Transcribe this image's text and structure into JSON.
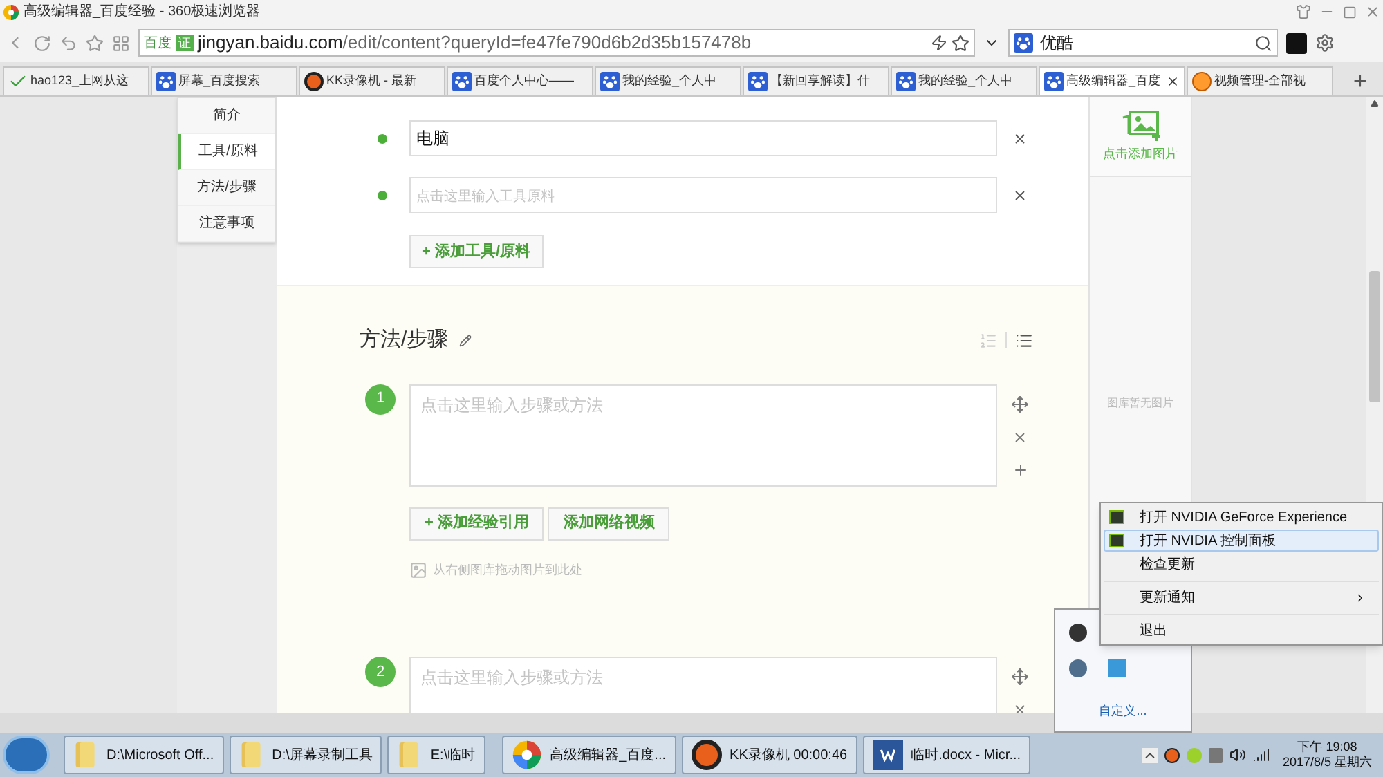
{
  "window": {
    "title": "高级编辑器_百度经验 - 360极速浏览器"
  },
  "toolbar": {
    "site_label": "百度",
    "cert_badge": "证",
    "url_host": "jingyan.baidu.com",
    "url_path": "/edit/content?queryId=fe47fe790d6b2d35b157478b",
    "search_value": "优酷"
  },
  "tabs": [
    {
      "label": "hao123_上网从这",
      "kind": "check",
      "selected": false
    },
    {
      "label": "屏幕_百度搜索",
      "kind": "paw",
      "selected": false
    },
    {
      "label": "KK录像机 - 最新",
      "kind": "recorder",
      "selected": false
    },
    {
      "label": "百度个人中心——",
      "kind": "paw",
      "selected": false
    },
    {
      "label": "我的经验_个人中",
      "kind": "paw",
      "selected": false
    },
    {
      "label": "【新回享解读】什",
      "kind": "paw",
      "selected": false
    },
    {
      "label": "我的经验_个人中",
      "kind": "paw",
      "selected": false
    },
    {
      "label": "高级编辑器_百度",
      "kind": "paw",
      "selected": true
    },
    {
      "label": "视频管理-全部视",
      "kind": "video",
      "selected": false
    }
  ],
  "nav": [
    {
      "label": "简介",
      "selected": false
    },
    {
      "label": "工具/原料",
      "selected": true
    },
    {
      "label": "方法/步骤",
      "selected": false
    },
    {
      "label": "注意事项",
      "selected": false
    }
  ],
  "tools": {
    "items": [
      {
        "value": "电脑"
      },
      {
        "placeholder": "点击这里输入工具原料"
      }
    ],
    "add_button": "+ 添加工具/原料"
  },
  "steps_section": {
    "title": "方法/步骤",
    "steps": [
      {
        "number": "1",
        "placeholder": "点击这里输入步骤或方法",
        "buttons": [
          "+ 添加经验引用",
          "添加网络视频"
        ],
        "drop_hint": "从右侧图库拖动图片到此处"
      },
      {
        "number": "2",
        "placeholder": "点击这里输入步骤或方法"
      }
    ]
  },
  "gallery": {
    "add_label": "点击添加图片",
    "empty_text": "图库暂无图片"
  },
  "context_menu": [
    {
      "label": "打开 NVIDIA GeForce Experience",
      "kind": "icon",
      "selected": false
    },
    {
      "label": "打开 NVIDIA 控制面板",
      "kind": "icon",
      "selected": true
    },
    {
      "label": "检查更新",
      "kind": "plain",
      "selected": false
    },
    {
      "label": "更新通知",
      "kind": "submenu",
      "selected": false
    },
    {
      "label": "退出",
      "kind": "last",
      "selected": false
    }
  ],
  "tray_overflow": {
    "customize_link": "自定义..."
  },
  "taskbar": [
    {
      "label": "D:\\Microsoft Off...",
      "kind": "folder"
    },
    {
      "label": "D:\\屏幕录制工具",
      "kind": "folder"
    },
    {
      "label": "E:\\临时",
      "kind": "folder"
    },
    {
      "label": "高级编辑器_百度...",
      "kind": "browser"
    },
    {
      "label": "KK录像机 00:00:46",
      "kind": "recorder"
    },
    {
      "label": "临时.docx - Micr...",
      "kind": "word"
    }
  ],
  "clock": {
    "time": "下午 19:08",
    "date": "2017/8/5 星期六"
  }
}
